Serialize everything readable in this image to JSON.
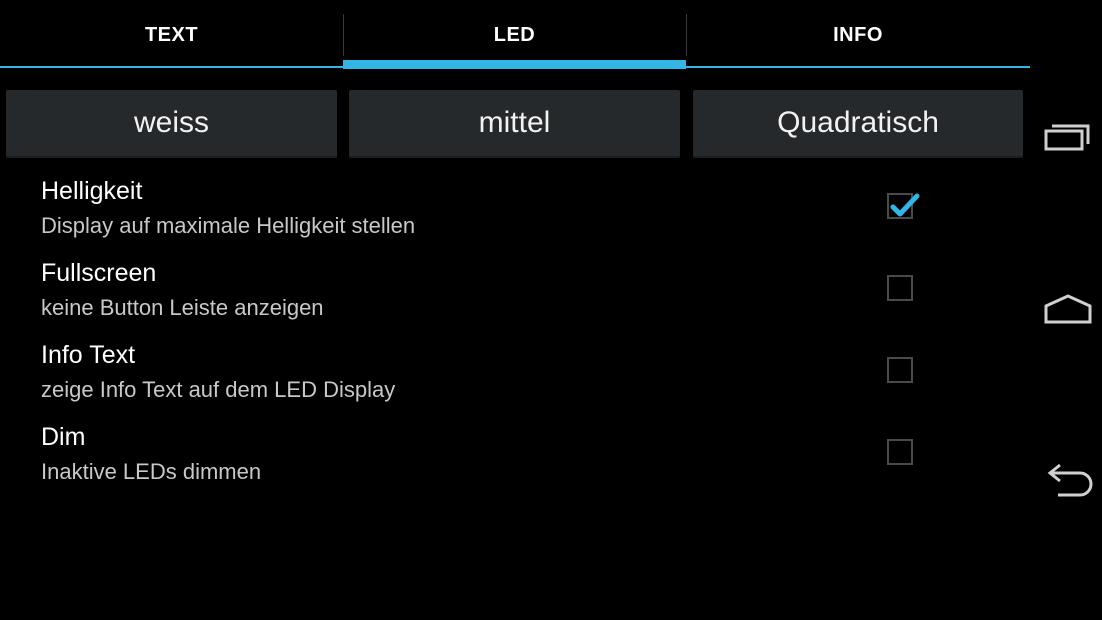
{
  "tabs": [
    {
      "label": "TEXT",
      "selected": false
    },
    {
      "label": "LED",
      "selected": true
    },
    {
      "label": "INFO",
      "selected": false
    }
  ],
  "buttons": {
    "color": "weiss",
    "size": "mittel",
    "shape": "Quadratisch"
  },
  "preferences": [
    {
      "title": "Helligkeit",
      "summary": "Display auf maximale Helligkeit stellen",
      "checked": true
    },
    {
      "title": "Fullscreen",
      "summary": "keine Button Leiste anzeigen",
      "checked": false
    },
    {
      "title": "Info Text",
      "summary": "zeige Info Text auf dem LED Display",
      "checked": false
    },
    {
      "title": "Dim",
      "summary": "Inaktive LEDs dimmen",
      "checked": false
    }
  ],
  "navigation": {
    "recent": "recent-apps-icon",
    "home": "home-icon",
    "back": "back-icon"
  },
  "colors": {
    "accent": "#33b5e5",
    "button_bg": "#26292c",
    "background": "#000000"
  }
}
